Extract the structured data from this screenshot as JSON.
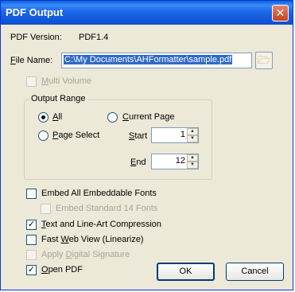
{
  "window": {
    "title": "PDF Output",
    "close_glyph": "✕"
  },
  "pdf_version": {
    "label": "PDF Version:",
    "value": "PDF1.4"
  },
  "file_name": {
    "label": "File Name:",
    "value": "C:\\My Documents\\AHFormatter\\sample.pdf",
    "browse_icon": "folder-open-icon"
  },
  "multi_volume": {
    "label": "Multi Volume",
    "checked": false,
    "enabled": false
  },
  "output_range": {
    "legend": "Output Range",
    "all_label": "All",
    "current_page_label": "Current Page",
    "page_select_label": "Page Select",
    "selected": "All",
    "start_label": "Start",
    "start_value": "1",
    "end_label": "End",
    "end_value": "12"
  },
  "options": {
    "embed_fonts": {
      "label": "Embed All Embeddable Fonts",
      "checked": false,
      "enabled": true
    },
    "embed_std14": {
      "label": "Embed Standard 14 Fonts",
      "checked": false,
      "enabled": false
    },
    "compression": {
      "label": "Text and Line-Art Compression",
      "checked": true,
      "enabled": true
    },
    "fast_web": {
      "label": "Fast Web View (Linearize)",
      "checked": false,
      "enabled": true
    },
    "digital_sig": {
      "label": "Apply Digital Signature",
      "checked": false,
      "enabled": false
    },
    "open_pdf": {
      "label": "Open PDF",
      "checked": true,
      "enabled": true
    }
  },
  "buttons": {
    "ok": "OK",
    "cancel": "Cancel"
  },
  "glyphs": {
    "check": "✓",
    "spin_up": "▲",
    "spin_down": "▼"
  }
}
